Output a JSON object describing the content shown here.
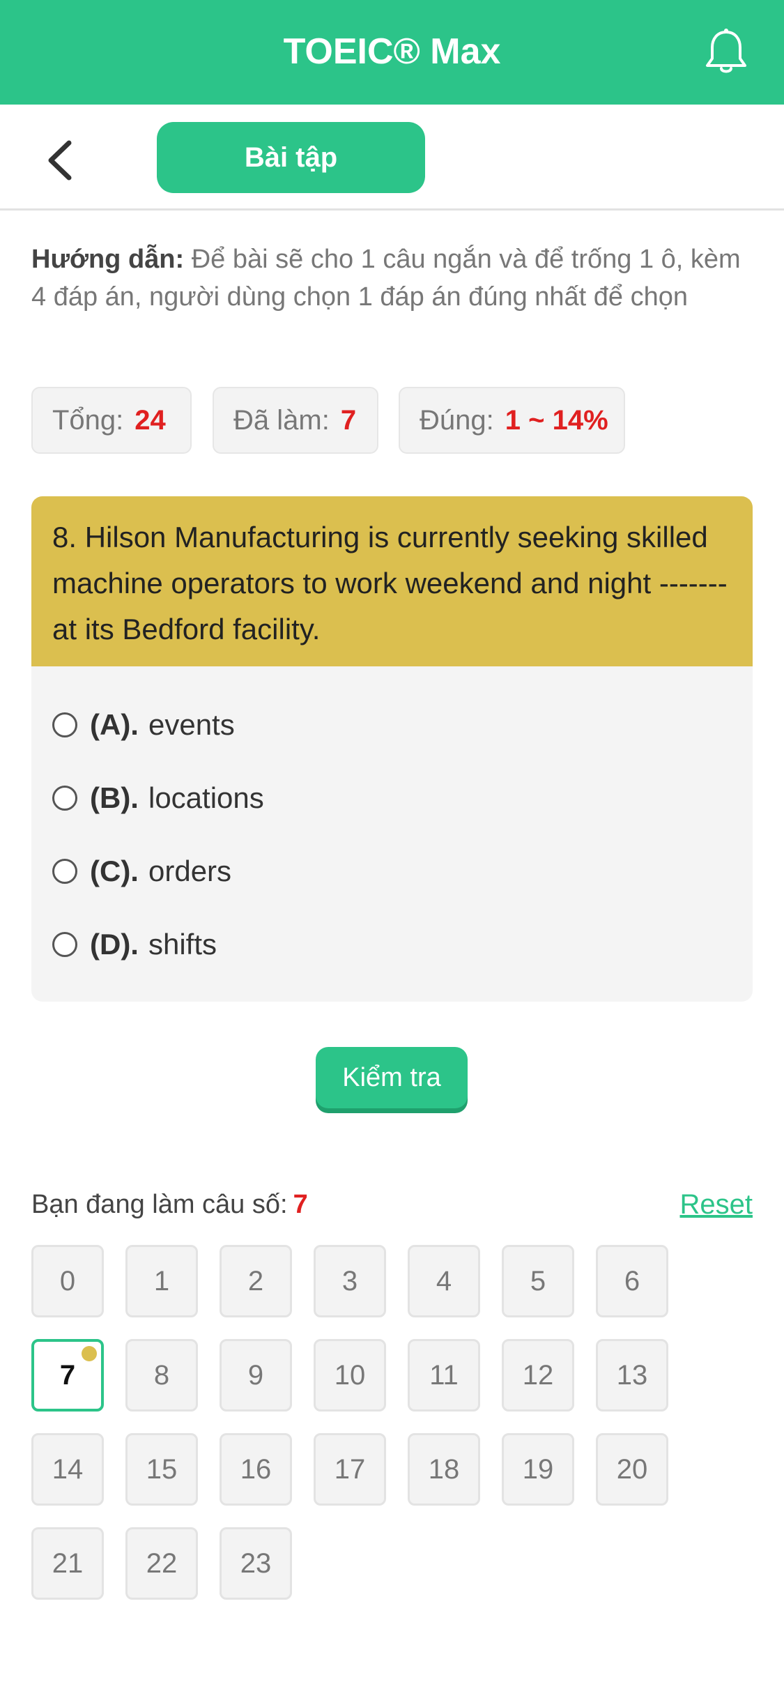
{
  "header": {
    "title": "TOEIC® Max",
    "bell_icon": "bell-icon"
  },
  "subnav": {
    "back_icon": "chevron-left-icon",
    "tab_label": "Bài tập"
  },
  "instructions": {
    "label": "Hướng dẫn:",
    "text": "Để bài sẽ cho 1 câu ngắn và để trống 1 ô, kèm 4 đáp án, người dùng chọn 1 đáp án đúng nhất để chọn"
  },
  "stats": {
    "total_label": "Tổng:",
    "total_value": "24",
    "done_label": "Đã làm:",
    "done_value": "7",
    "correct_label": "Đúng:",
    "correct_value": "1 ~ 14%"
  },
  "question": {
    "text": "8. Hilson Manufacturing is currently seeking skilled machine operators to work weekend and night ------- at its Bedford facility.",
    "options": [
      {
        "letter": "(A).",
        "text": "events"
      },
      {
        "letter": "(B).",
        "text": "locations"
      },
      {
        "letter": "(C).",
        "text": "orders"
      },
      {
        "letter": "(D).",
        "text": "shifts"
      }
    ]
  },
  "check_button": "Kiểm tra",
  "progress": {
    "label": "Bạn đang làm câu số:",
    "current": "7",
    "reset_label": "Reset"
  },
  "question_grid": {
    "numbers": [
      "0",
      "1",
      "2",
      "3",
      "4",
      "5",
      "6",
      "7",
      "8",
      "9",
      "10",
      "11",
      "12",
      "13",
      "14",
      "15",
      "16",
      "17",
      "18",
      "19",
      "20",
      "21",
      "22",
      "23"
    ],
    "current_index": 7
  },
  "colors": {
    "primary": "#2cc489",
    "question_header": "#dbbf4f",
    "accent_red": "#e02020"
  }
}
